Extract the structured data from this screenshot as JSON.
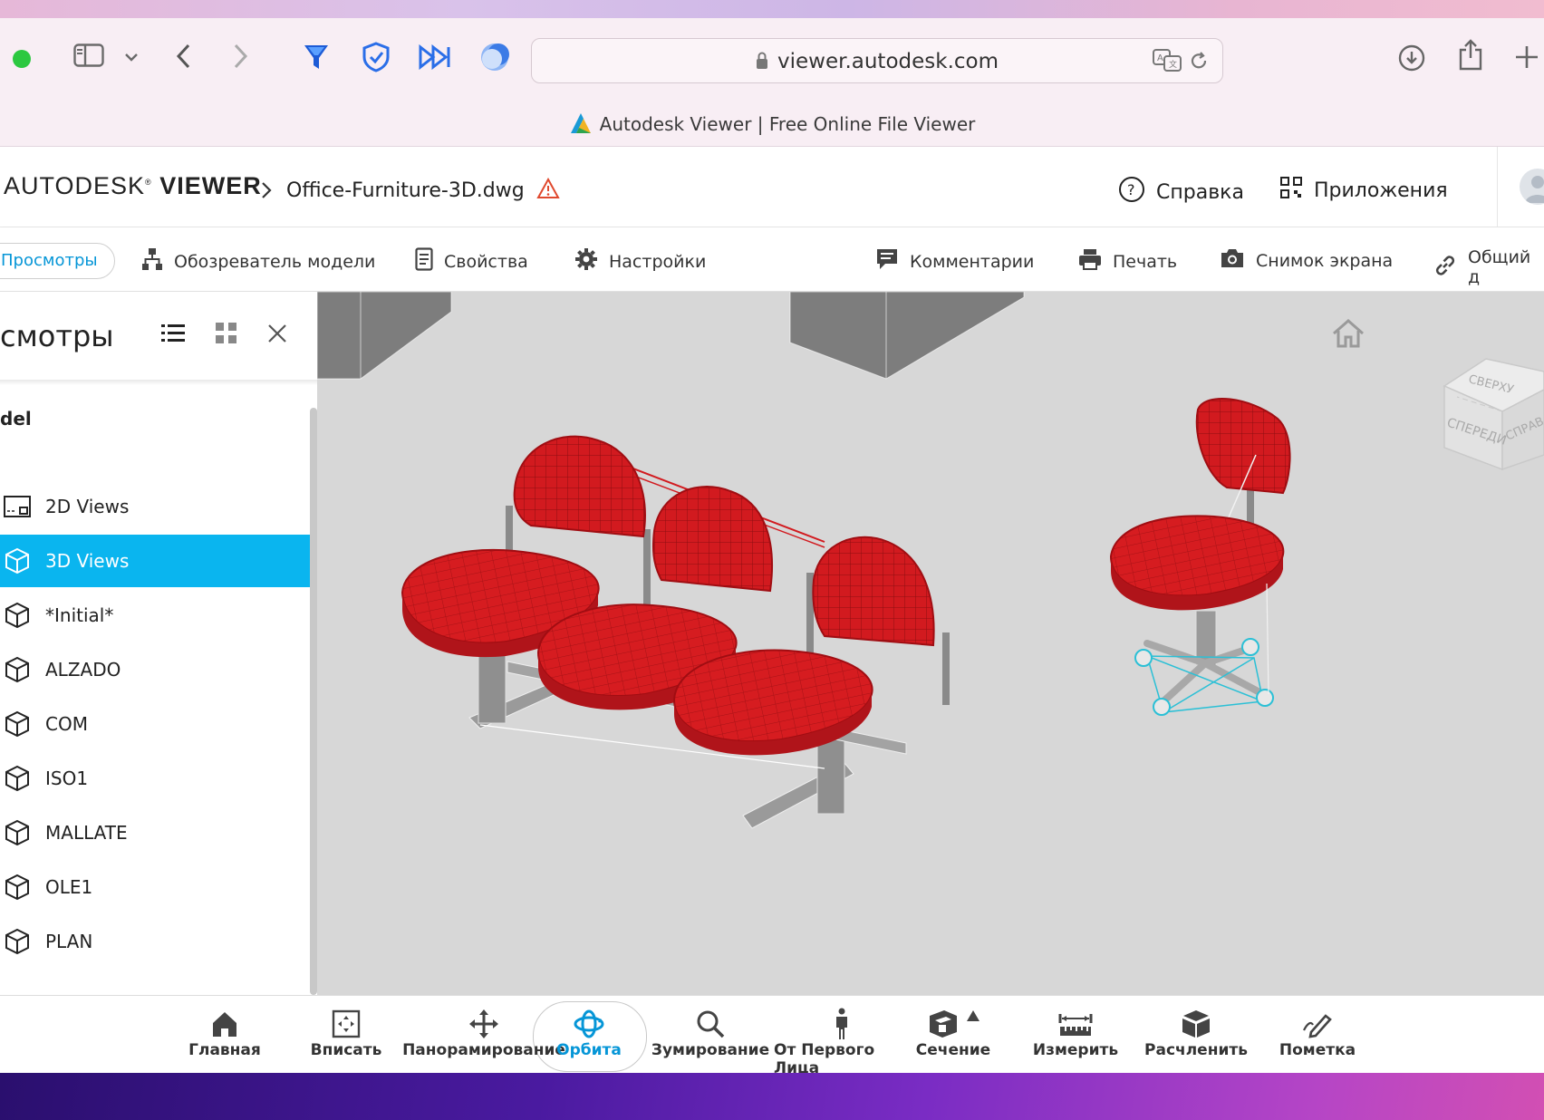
{
  "browser": {
    "url": "viewer.autodesk.com",
    "tab_title": "Autodesk Viewer | Free Online File Viewer"
  },
  "header": {
    "brand_prefix": "AUTODESK",
    "brand_suffix": "VIEWER",
    "file_name": "Office-Furniture-3D.dwg",
    "help_label": "Справка",
    "apps_label": "Приложения"
  },
  "toolbar": {
    "views_label": "Просмотры",
    "model_browser_label": "Обозреватель модели",
    "properties_label": "Свойства",
    "settings_label": "Настройки",
    "comments_label": "Комментарии",
    "print_label": "Печать",
    "screenshot_label": "Снимок экрана",
    "share_label": "Общий д"
  },
  "panel": {
    "title": "смотры",
    "section": "del",
    "items": [
      {
        "label": "2D Views"
      },
      {
        "label": "3D Views"
      },
      {
        "label": "*Initial*"
      },
      {
        "label": "ALZADO"
      },
      {
        "label": "COM"
      },
      {
        "label": "ISO1"
      },
      {
        "label": "MALLATE"
      },
      {
        "label": "OLE1"
      },
      {
        "label": "PLAN"
      }
    ]
  },
  "viewcube": {
    "top": "СВЕРХУ",
    "front": "СПЕРЕДИ",
    "right": "СПРАВА"
  },
  "bottom": {
    "home": "Главная",
    "fit": "Вписать",
    "pan": "Панорамирование",
    "orbit": "Орбита",
    "zoom": "Зумирование",
    "first_person": "От Первого Лица",
    "section": "Сечение",
    "measure": "Измерить",
    "explode": "Расчленить",
    "markup": "Пометка"
  },
  "colors": {
    "accent": "#0696d7",
    "selected_row": "#0ab5ef",
    "seat_red": "#c8141a"
  }
}
